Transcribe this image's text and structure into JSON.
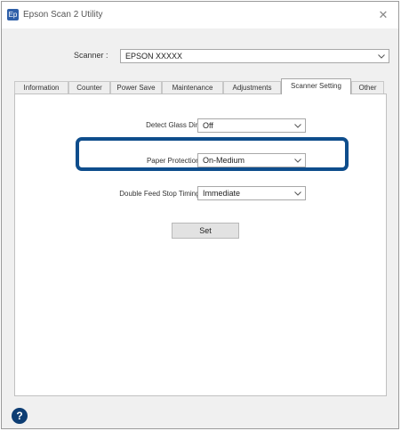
{
  "window": {
    "title": "Epson Scan 2 Utility",
    "app_icon_glyph": "Ep",
    "close_glyph": "✕"
  },
  "scanner": {
    "label": "Scanner :",
    "value": "EPSON XXXXX"
  },
  "tabs": [
    {
      "label": "Information",
      "active": false
    },
    {
      "label": "Counter",
      "active": false
    },
    {
      "label": "Power Save",
      "active": false
    },
    {
      "label": "Maintenance",
      "active": false
    },
    {
      "label": "Adjustments",
      "active": false
    },
    {
      "label": "Scanner Setting",
      "active": true
    },
    {
      "label": "Other",
      "active": false
    }
  ],
  "settings": {
    "detect_glass_dirt": {
      "label": "Detect Glass Dirt :",
      "value": "Off"
    },
    "paper_protection": {
      "label": "Paper Protection :",
      "value": "On-Medium"
    },
    "double_feed_stop_timing": {
      "label": "Double Feed Stop Timing :",
      "value": "Immediate"
    },
    "set_button": "Set"
  },
  "help": {
    "glyph": "?"
  },
  "colors": {
    "highlight": "#0e4d8c",
    "help_icon": "#0d3d73"
  }
}
